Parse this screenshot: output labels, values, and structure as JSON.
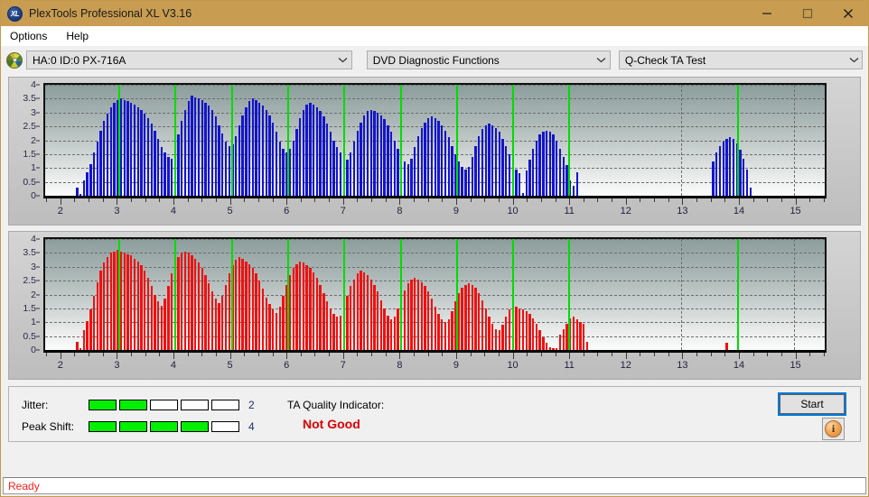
{
  "window": {
    "title": "PlexTools Professional XL V3.16",
    "icon": "XL",
    "controls": {
      "minimize": "minimize-icon",
      "maximize": "maximize-icon",
      "close": "close-icon"
    },
    "titlebar_color": "#c89d52"
  },
  "menu": {
    "items": [
      "Options",
      "Help"
    ]
  },
  "toolbar": {
    "drive": {
      "value": "HA:0 ID:0  PX-716A",
      "icon": "disc-icon"
    },
    "function": {
      "value": "DVD Diagnostic Functions"
    },
    "test": {
      "value": "Q-Check TA Test"
    }
  },
  "results": {
    "jitter_label": "Jitter:",
    "jitter_value": "2",
    "jitter_segments": 5,
    "jitter_filled": 2,
    "peak_shift_label": "Peak Shift:",
    "peak_shift_value": "4",
    "peak_shift_segments": 5,
    "peak_shift_filled": 4,
    "ta_title": "TA Quality Indicator:",
    "ta_value": "Not Good",
    "ta_color": "#dd0000",
    "start_label": "Start",
    "info_label": "i"
  },
  "status": {
    "text": "Ready",
    "color": "#ff2020"
  },
  "chart_data": [
    {
      "id": "top",
      "type": "bar",
      "title": "",
      "xlabel": "",
      "ylabel": "",
      "color": "#1414cc",
      "marker_color": "#00dd00",
      "grid": true,
      "xlim": [
        1.7,
        15.55
      ],
      "ylim": [
        0,
        4
      ],
      "yticks": [
        0,
        0.5,
        1,
        1.5,
        2,
        2.5,
        3,
        3.5,
        4
      ],
      "ytick_labels": [
        "0",
        "0.5",
        "1",
        "1.5",
        "2",
        "2.5",
        "3",
        "3.5",
        "4"
      ],
      "xticks": [
        2,
        3,
        4,
        5,
        6,
        7,
        8,
        9,
        10,
        11,
        12,
        13,
        14,
        15
      ],
      "xtick_labels": [
        "2",
        "3",
        "4",
        "5",
        "6",
        "7",
        "8",
        "9",
        "10",
        "11",
        "12",
        "13",
        "14",
        "15"
      ],
      "markers": [
        3,
        4,
        5,
        6,
        7,
        8,
        9,
        10,
        11,
        14
      ],
      "x": [
        2.25,
        2.31,
        2.37,
        2.43,
        2.49,
        2.55,
        2.61,
        2.67,
        2.73,
        2.79,
        2.85,
        2.91,
        2.97,
        3.03,
        3.09,
        3.15,
        3.21,
        3.27,
        3.33,
        3.39,
        3.45,
        3.51,
        3.57,
        3.63,
        3.69,
        3.75,
        3.81,
        3.87,
        3.93,
        3.99,
        4.05,
        4.11,
        4.17,
        4.23,
        4.29,
        4.35,
        4.41,
        4.47,
        4.53,
        4.59,
        4.65,
        4.71,
        4.77,
        4.83,
        4.89,
        4.95,
        5.01,
        5.07,
        5.13,
        5.19,
        5.25,
        5.31,
        5.37,
        5.43,
        5.49,
        5.55,
        5.61,
        5.67,
        5.73,
        5.79,
        5.85,
        5.91,
        5.97,
        6.03,
        6.09,
        6.15,
        6.21,
        6.27,
        6.33,
        6.39,
        6.45,
        6.51,
        6.57,
        6.63,
        6.69,
        6.75,
        6.81,
        6.87,
        6.93,
        6.99,
        7.05,
        7.11,
        7.17,
        7.23,
        7.29,
        7.35,
        7.41,
        7.47,
        7.53,
        7.59,
        7.65,
        7.71,
        7.77,
        7.83,
        7.89,
        7.95,
        8.01,
        8.07,
        8.13,
        8.19,
        8.25,
        8.31,
        8.37,
        8.43,
        8.49,
        8.55,
        8.61,
        8.67,
        8.73,
        8.79,
        8.85,
        8.91,
        8.97,
        9.03,
        9.09,
        9.15,
        9.21,
        9.27,
        9.33,
        9.39,
        9.45,
        9.51,
        9.57,
        9.63,
        9.69,
        9.75,
        9.81,
        9.87,
        9.93,
        9.99,
        10.05,
        10.11,
        10.17,
        10.23,
        10.29,
        10.35,
        10.41,
        10.47,
        10.53,
        10.59,
        10.65,
        10.71,
        10.77,
        10.83,
        10.89,
        10.95,
        11.01,
        11.07,
        11.13,
        13.55,
        13.61,
        13.67,
        13.73,
        13.79,
        13.85,
        13.91,
        13.97,
        14.03,
        14.09,
        14.15,
        14.21,
        14.27
      ],
      "values": [
        0.3,
        0.05,
        0.55,
        0.85,
        1.15,
        1.55,
        1.95,
        2.35,
        2.7,
        2.95,
        3.2,
        3.35,
        3.45,
        3.5,
        3.45,
        3.4,
        3.35,
        3.3,
        3.2,
        3.1,
        2.95,
        2.8,
        2.6,
        2.35,
        2.05,
        1.75,
        1.55,
        1.4,
        1.35,
        1.7,
        2.2,
        2.7,
        3.1,
        3.4,
        3.6,
        3.55,
        3.5,
        3.45,
        3.35,
        3.25,
        3.1,
        2.85,
        2.55,
        2.25,
        1.95,
        1.8,
        1.85,
        2.15,
        2.55,
        2.9,
        3.2,
        3.4,
        3.5,
        3.45,
        3.35,
        3.25,
        3.1,
        2.9,
        2.65,
        2.3,
        1.95,
        1.7,
        1.55,
        1.7,
        2.0,
        2.4,
        2.8,
        3.1,
        3.3,
        3.35,
        3.3,
        3.2,
        3.05,
        2.85,
        2.6,
        2.3,
        2.0,
        1.75,
        1.55,
        1.5,
        1.3,
        1.55,
        1.95,
        2.35,
        2.65,
        2.9,
        3.05,
        3.1,
        3.05,
        3.0,
        2.9,
        2.75,
        2.55,
        2.3,
        2.0,
        1.7,
        1.45,
        1.25,
        1.15,
        1.35,
        1.75,
        2.15,
        2.45,
        2.65,
        2.8,
        2.85,
        2.8,
        2.7,
        2.55,
        2.35,
        2.1,
        1.8,
        1.5,
        1.25,
        1.05,
        0.95,
        1.05,
        1.4,
        1.8,
        2.15,
        2.4,
        2.55,
        2.6,
        2.55,
        2.45,
        2.3,
        2.05,
        1.8,
        1.5,
        1.2,
        0.95,
        0.8,
        0.1,
        0.9,
        1.3,
        1.7,
        2.0,
        2.2,
        2.3,
        2.35,
        2.3,
        2.2,
        2.0,
        1.7,
        1.4,
        1.1,
        0.55,
        0.35,
        0.85,
        1.25,
        1.55,
        1.8,
        1.95,
        2.05,
        2.1,
        2.05,
        1.9,
        1.65,
        1.35,
        0.95,
        0.3
      ]
    },
    {
      "id": "bottom",
      "type": "bar",
      "title": "",
      "xlabel": "",
      "ylabel": "",
      "color": "#f01010",
      "marker_color": "#00dd00",
      "grid": true,
      "xlim": [
        1.7,
        15.55
      ],
      "ylim": [
        0,
        4
      ],
      "yticks": [
        0,
        0.5,
        1,
        1.5,
        2,
        2.5,
        3,
        3.5,
        4
      ],
      "ytick_labels": [
        "0",
        "0.5",
        "1",
        "1.5",
        "2",
        "2.5",
        "3",
        "3.5",
        "4"
      ],
      "xticks": [
        2,
        3,
        4,
        5,
        6,
        7,
        8,
        9,
        10,
        11,
        12,
        13,
        14,
        15
      ],
      "xtick_labels": [
        "2",
        "3",
        "4",
        "5",
        "6",
        "7",
        "8",
        "9",
        "10",
        "11",
        "12",
        "13",
        "14",
        "15"
      ],
      "markers": [
        3,
        4,
        5,
        6,
        7,
        8,
        9,
        10,
        11,
        14
      ],
      "x": [
        2.25,
        2.31,
        2.37,
        2.43,
        2.49,
        2.55,
        2.61,
        2.67,
        2.73,
        2.79,
        2.85,
        2.91,
        2.97,
        3.03,
        3.09,
        3.15,
        3.21,
        3.27,
        3.33,
        3.39,
        3.45,
        3.51,
        3.57,
        3.63,
        3.69,
        3.75,
        3.81,
        3.87,
        3.93,
        3.99,
        4.05,
        4.11,
        4.17,
        4.23,
        4.29,
        4.35,
        4.41,
        4.47,
        4.53,
        4.59,
        4.65,
        4.71,
        4.77,
        4.83,
        4.89,
        4.95,
        5.01,
        5.07,
        5.13,
        5.19,
        5.25,
        5.31,
        5.37,
        5.43,
        5.49,
        5.55,
        5.61,
        5.67,
        5.73,
        5.79,
        5.85,
        5.91,
        5.97,
        6.03,
        6.09,
        6.15,
        6.21,
        6.27,
        6.33,
        6.39,
        6.45,
        6.51,
        6.57,
        6.63,
        6.69,
        6.75,
        6.81,
        6.87,
        6.93,
        6.99,
        7.05,
        7.11,
        7.17,
        7.23,
        7.29,
        7.35,
        7.41,
        7.47,
        7.53,
        7.59,
        7.65,
        7.71,
        7.77,
        7.83,
        7.89,
        7.95,
        8.01,
        8.07,
        8.13,
        8.19,
        8.25,
        8.31,
        8.37,
        8.43,
        8.49,
        8.55,
        8.61,
        8.67,
        8.73,
        8.79,
        8.85,
        8.91,
        8.97,
        9.03,
        9.09,
        9.15,
        9.21,
        9.27,
        9.33,
        9.39,
        9.45,
        9.51,
        9.57,
        9.63,
        9.69,
        9.75,
        9.81,
        9.87,
        9.93,
        9.99,
        10.05,
        10.11,
        10.17,
        10.23,
        10.29,
        10.35,
        10.41,
        10.47,
        10.53,
        10.59,
        10.65,
        10.71,
        10.77,
        10.83,
        10.89,
        10.95,
        11.01,
        11.07,
        11.13,
        11.19,
        11.25,
        11.31,
        13.79,
        13.85,
        13.91,
        13.97,
        14.03,
        14.09,
        14.15,
        14.21,
        14.27,
        14.33
      ],
      "values": [
        0.3,
        0.05,
        0.7,
        1.05,
        1.45,
        1.95,
        2.45,
        2.85,
        3.15,
        3.35,
        3.5,
        3.55,
        3.6,
        3.55,
        3.5,
        3.45,
        3.4,
        3.3,
        3.2,
        3.05,
        2.85,
        2.6,
        2.3,
        2.0,
        1.75,
        1.6,
        1.85,
        2.3,
        2.75,
        3.1,
        3.35,
        3.5,
        3.55,
        3.5,
        3.4,
        3.3,
        3.15,
        2.95,
        2.7,
        2.4,
        2.1,
        1.85,
        1.7,
        1.95,
        2.35,
        2.75,
        3.05,
        3.25,
        3.35,
        3.3,
        3.2,
        3.1,
        2.95,
        2.75,
        2.5,
        2.2,
        1.9,
        1.65,
        1.45,
        1.35,
        1.55,
        1.95,
        2.35,
        2.7,
        2.95,
        3.1,
        3.2,
        3.15,
        3.05,
        2.95,
        2.8,
        2.6,
        2.35,
        2.05,
        1.75,
        1.5,
        1.3,
        1.2,
        1.25,
        1.55,
        1.95,
        2.3,
        2.55,
        2.75,
        2.85,
        2.8,
        2.7,
        2.55,
        2.35,
        2.1,
        1.8,
        1.5,
        1.25,
        1.1,
        1.2,
        1.5,
        1.85,
        2.15,
        2.4,
        2.55,
        2.6,
        2.55,
        2.45,
        2.3,
        2.1,
        1.85,
        1.55,
        1.3,
        1.1,
        1.0,
        1.1,
        1.4,
        1.75,
        2.05,
        2.25,
        2.35,
        2.4,
        2.35,
        2.25,
        2.05,
        1.8,
        1.5,
        1.2,
        0.95,
        0.75,
        0.7,
        0.9,
        1.2,
        1.45,
        1.55,
        1.55,
        1.5,
        1.45,
        1.4,
        1.3,
        1.15,
        0.95,
        0.7,
        0.45,
        0.25,
        0.1,
        0.05,
        0.05,
        0.55,
        0.75,
        0.95,
        1.15,
        1.2,
        1.1,
        1.0,
        0.95,
        0.3,
        0.25
      ]
    }
  ]
}
